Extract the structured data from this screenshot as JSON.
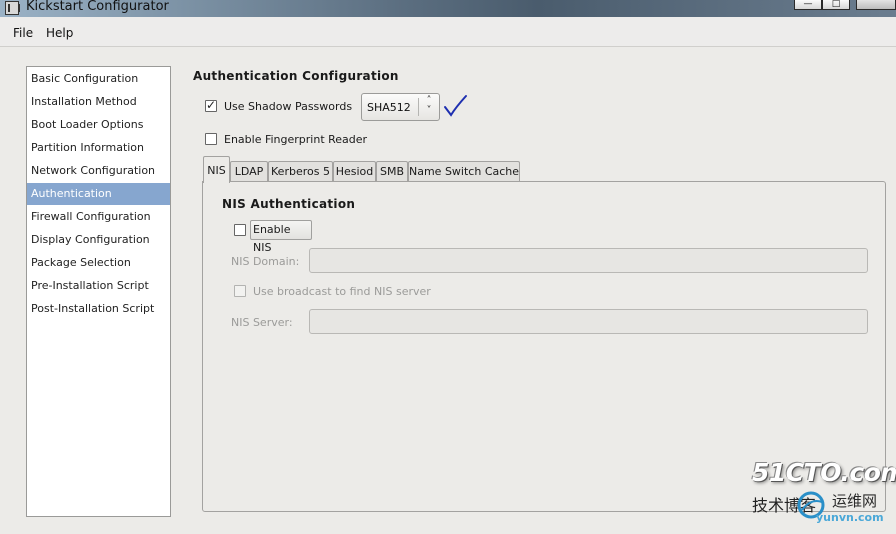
{
  "window": {
    "title": "Kickstart Configurator"
  },
  "menubar": {
    "file": "File",
    "help": "Help"
  },
  "sidebar": {
    "items": [
      {
        "label": "Basic Configuration"
      },
      {
        "label": "Installation Method"
      },
      {
        "label": "Boot Loader Options"
      },
      {
        "label": "Partition Information"
      },
      {
        "label": "Network Configuration"
      },
      {
        "label": "Authentication",
        "selected": true
      },
      {
        "label": "Firewall Configuration"
      },
      {
        "label": "Display Configuration"
      },
      {
        "label": "Package Selection"
      },
      {
        "label": "Pre-Installation Script"
      },
      {
        "label": "Post-Installation Script"
      }
    ]
  },
  "auth": {
    "title": "Authentication Configuration",
    "shadow_label": "Use Shadow Passwords",
    "shadow_checked": true,
    "hash_value": "SHA512",
    "fingerprint_label": "Enable Fingerprint Reader",
    "fingerprint_checked": false
  },
  "tabs": [
    {
      "label": "NIS",
      "active": true
    },
    {
      "label": "LDAP"
    },
    {
      "label": "Kerberos 5"
    },
    {
      "label": "Hesiod"
    },
    {
      "label": "SMB"
    },
    {
      "label": "Name Switch Cache"
    }
  ],
  "nis": {
    "title": "NIS Authentication",
    "enable_label": "Enable NIS",
    "enable_checked": false,
    "domain_label": "NIS Domain:",
    "domain_value": "",
    "broadcast_label": "Use broadcast to find NIS server",
    "server_label": "NIS Server:",
    "server_value": ""
  },
  "watermark": {
    "main": "51CTO.com",
    "sub": "技术博客",
    "sub2": "运维网",
    "url": "yunvn.com"
  },
  "colors": {
    "selection": "#86a6cf",
    "annotation_check": "#1e2fb0"
  }
}
